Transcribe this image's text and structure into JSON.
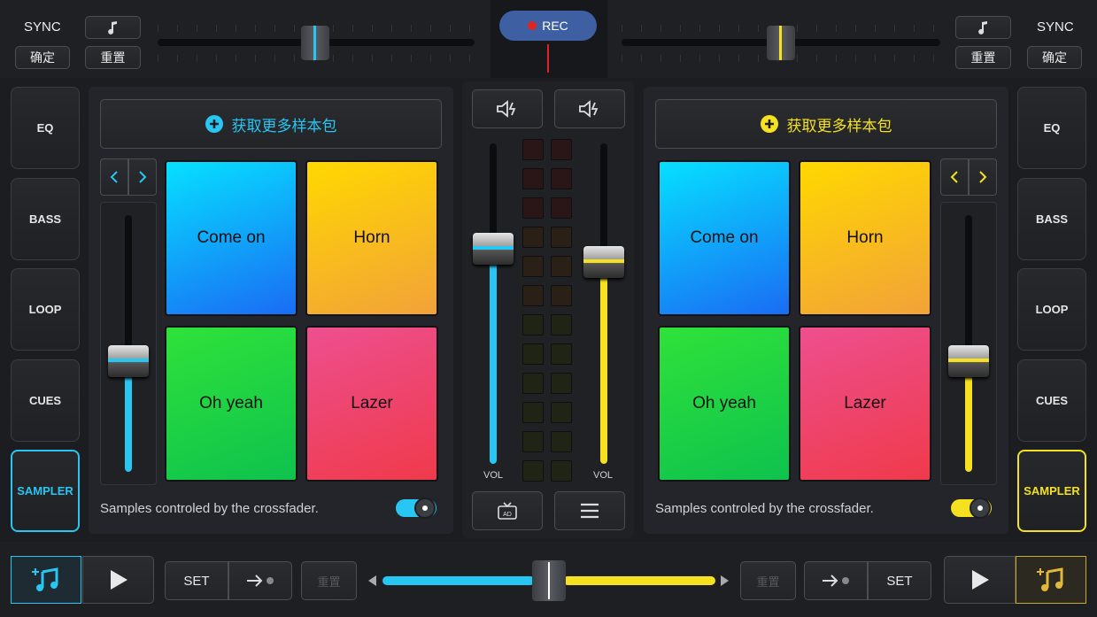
{
  "colors": {
    "left_accent": "#27c6f3",
    "right_accent": "#f5e11f",
    "rec": "#e02424"
  },
  "top": {
    "left": {
      "sync": "SYNC",
      "confirm": "确定",
      "reset": "重置",
      "note_icon": "music-note-icon",
      "pitch": 0.5
    },
    "right": {
      "sync": "SYNC",
      "confirm": "确定",
      "reset": "重置",
      "note_icon": "music-note-icon",
      "pitch": 0.5
    },
    "rec": "REC"
  },
  "left_tabs": [
    "EQ",
    "BASS",
    "LOOP",
    "CUES",
    "SAMPLER"
  ],
  "right_tabs": [
    "EQ",
    "BASS",
    "LOOP",
    "CUES",
    "SAMPLER"
  ],
  "left_deck": {
    "get_more": "获取更多样本包",
    "pads": [
      "Come on",
      "Horn",
      "Oh yeah",
      "Lazer"
    ],
    "crossfader_note": "Samples controled by the crossfader.",
    "toggle_on": true,
    "slider_level": 0.43
  },
  "right_deck": {
    "get_more": "获取更多样本包",
    "pads": [
      "Come on",
      "Horn",
      "Oh yeah",
      "Lazer"
    ],
    "crossfader_note": "Samples controled by the crossfader.",
    "toggle_on": true,
    "slider_level": 0.43
  },
  "mixer": {
    "vol_left_label": "VOL",
    "vol_right_label": "VOL",
    "vol_left": 0.67,
    "vol_right": 0.63
  },
  "bottom": {
    "left": {
      "set": "SET",
      "reset": "重置"
    },
    "right": {
      "set": "SET",
      "reset": "重置"
    },
    "crossfader": 0.5
  }
}
